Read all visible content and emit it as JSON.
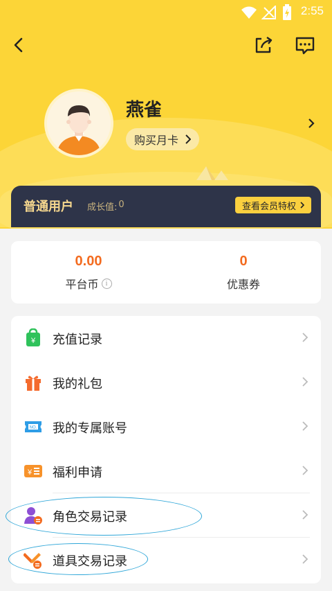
{
  "status_bar": {
    "time": "2:55"
  },
  "profile": {
    "username": "燕雀",
    "buy_card_label": "购买月卡"
  },
  "member": {
    "level": "普通用户",
    "growth_label": "成长值:",
    "growth_value": "0",
    "vip_button": "查看会员特权"
  },
  "stats": [
    {
      "value": "0.00",
      "label": "平台币",
      "has_info": true
    },
    {
      "value": "0",
      "label": "优惠券"
    }
  ],
  "menu": [
    {
      "label": "充值记录",
      "icon": "recharge-bag-icon"
    },
    {
      "label": "我的礼包",
      "icon": "gift-icon"
    },
    {
      "label": "我的专属账号",
      "icon": "ticket-no-icon"
    },
    {
      "label": "福利申请",
      "icon": "welfare-yen-icon"
    },
    {
      "label": "角色交易记录",
      "icon": "role-trade-icon"
    },
    {
      "label": "道具交易记录",
      "icon": "item-trade-icon"
    }
  ],
  "colors": {
    "header": "#fcd537",
    "member_bar": "#2e3449",
    "accent_orange": "#f36b1f",
    "highlight": "#2ea6d8"
  }
}
